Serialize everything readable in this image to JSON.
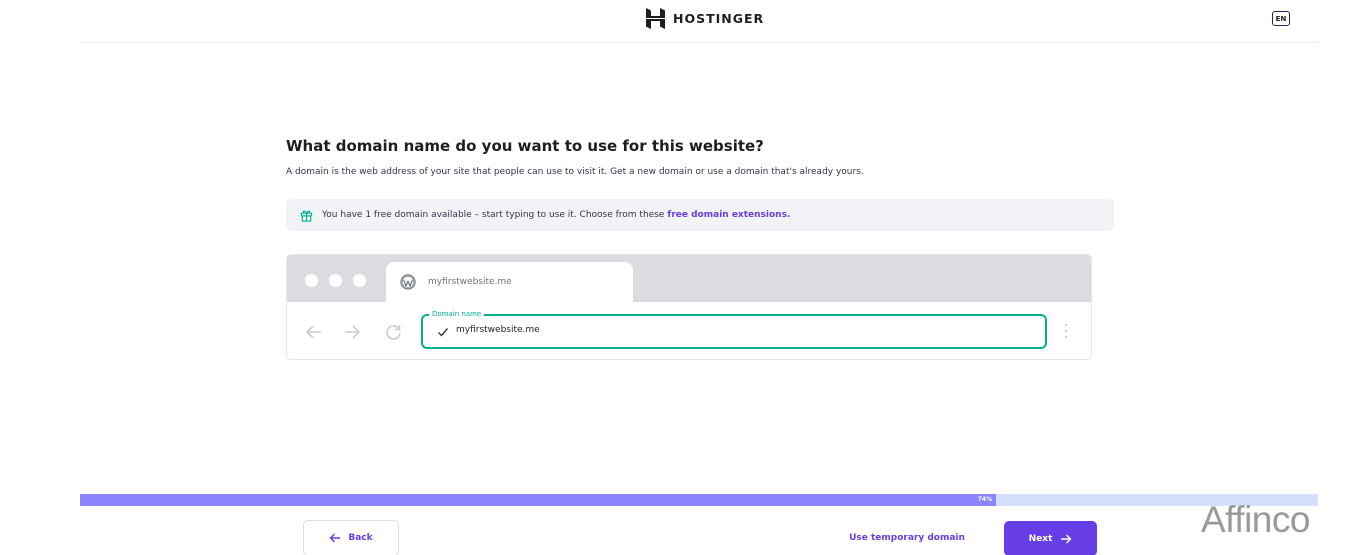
{
  "header": {
    "brand": "HOSTINGER",
    "language": "EN"
  },
  "main": {
    "title": "What domain name do you want to use for this website?",
    "subtitle": "A domain is the web address of your site that people can use to visit it. Get a new domain or use a domain that's already yours.",
    "notice": {
      "text": "You have 1 free domain available – start typing to use it. Choose from these",
      "link": "free domain extensions."
    }
  },
  "browser_preview": {
    "tab_label": "myfirstwebsite.me",
    "domain_field": {
      "label": "Domain name",
      "value": "myfirstwebsite.me"
    }
  },
  "progress": {
    "value": 0.74,
    "label": "74%"
  },
  "footer": {
    "back_label": "Back",
    "temporary_label": "Use temporary domain",
    "next_label": "Next"
  },
  "watermark": "Affinco",
  "colors": {
    "accent": "#673de6",
    "success": "#00b090",
    "progress_fill": "#8c85ff",
    "progress_track": "#d5dfff"
  },
  "icons": {
    "logo": "hostinger-logo-icon",
    "gift": "gift-icon",
    "wordpress": "wordpress-icon",
    "back": "arrow-left-icon",
    "forward": "arrow-right-icon",
    "reload": "reload-icon",
    "check": "check-icon",
    "menu": "kebab-menu-icon",
    "next": "arrow-right-icon"
  }
}
